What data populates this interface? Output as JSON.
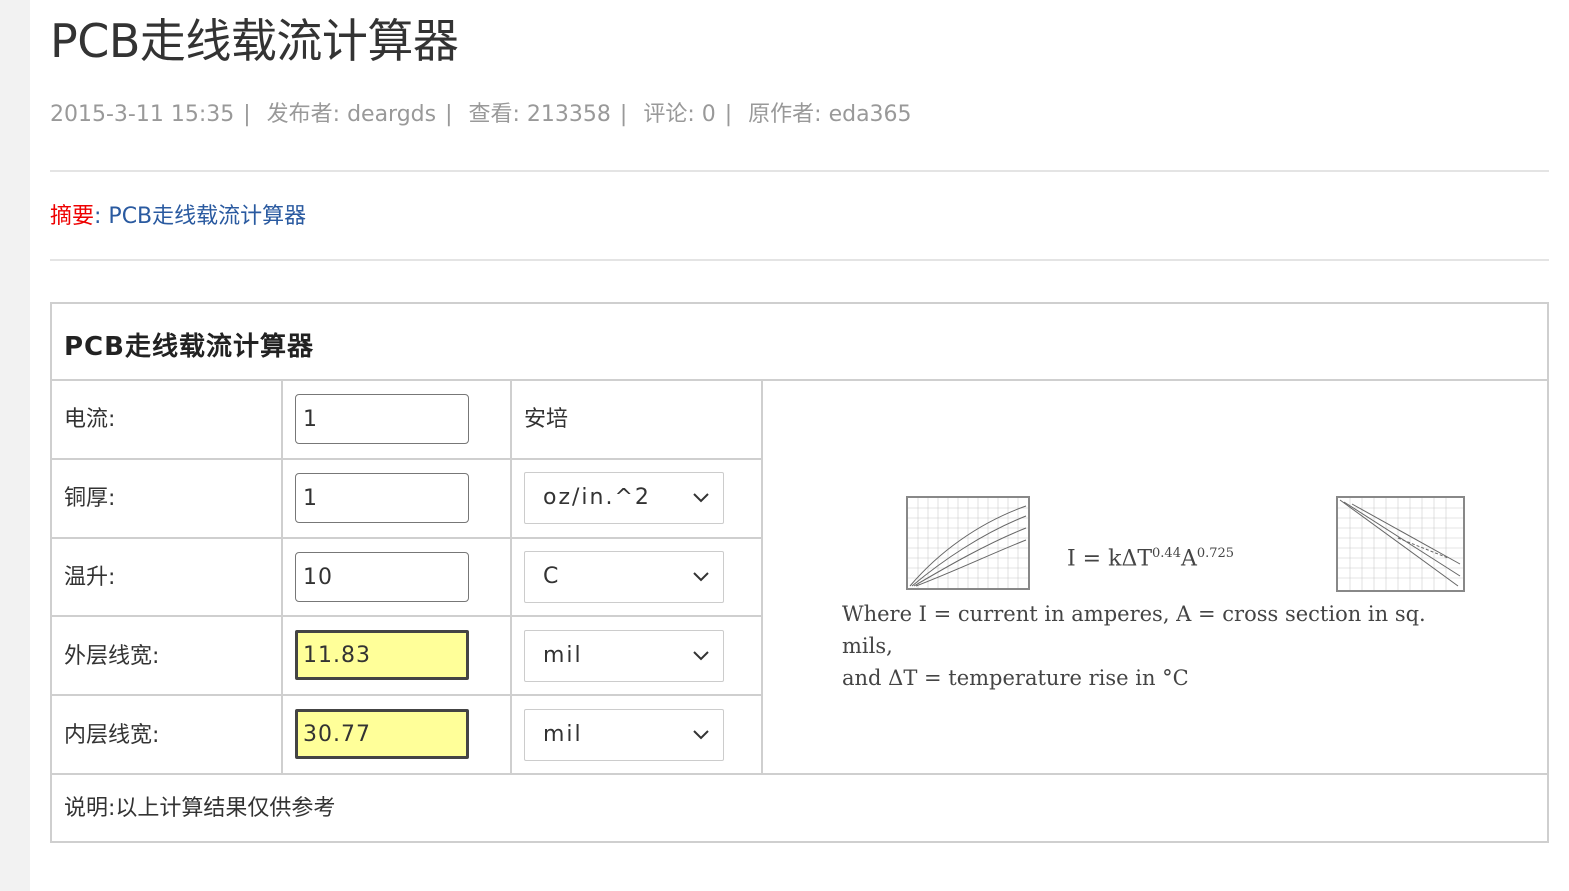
{
  "page": {
    "title": "PCB走线载流计算器",
    "meta": {
      "date": "2015-3-11 15:35",
      "publisher": "发布者: deargds",
      "views": "查看: 213358",
      "comments": "评论: 0",
      "author": "原作者: eda365"
    },
    "summary": {
      "label": "摘要",
      "text": "PCB走线载流计算器"
    }
  },
  "calculator": {
    "title": "PCB走线载流计算器",
    "rows": [
      {
        "label": "电流:",
        "value": "1",
        "unit": "安培"
      },
      {
        "label": "铜厚:",
        "value": "1",
        "unit": "oz/in.^2"
      },
      {
        "label": "温升:",
        "value": "10",
        "unit": "C"
      },
      {
        "label": "外层线宽:",
        "value": "11.83",
        "unit": "mil"
      },
      {
        "label": "内层线宽:",
        "value": "30.77",
        "unit": "mil"
      }
    ],
    "formula": {
      "text": "I = kΔT",
      "exp1": "0.44",
      "base2": "A",
      "exp2": "0.725",
      "caption_line1": "Where I = current in amperes, A = cross section in sq. mils,",
      "caption_line2": "and ΔT = temperature rise in °C"
    },
    "note": "说明:以上计算结果仅供参考"
  },
  "colors": {
    "accent_red": "#ee0000",
    "link_blue": "#2a5aa0",
    "output_fill": "#ffff99"
  }
}
